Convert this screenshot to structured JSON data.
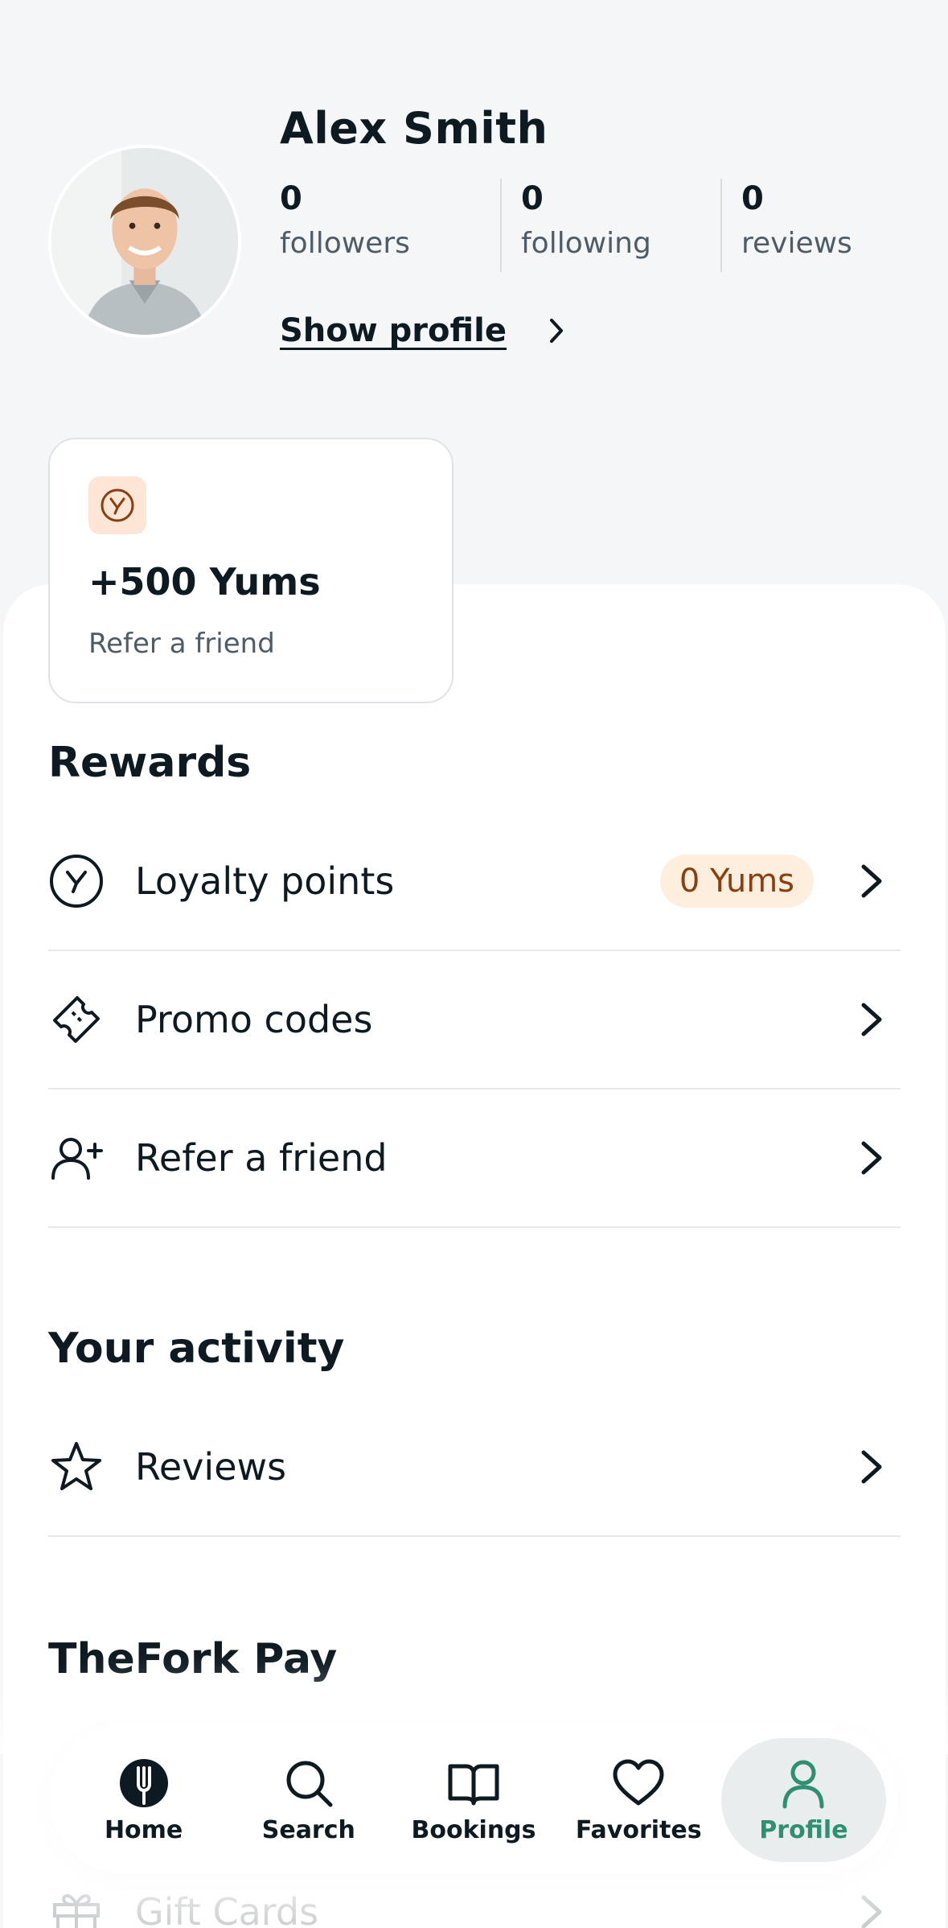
{
  "profile": {
    "name": "Alex Smith",
    "stats": [
      {
        "value": "0",
        "label": "followers"
      },
      {
        "value": "0",
        "label": "following"
      },
      {
        "value": "0",
        "label": "reviews"
      }
    ],
    "show_profile": "Show profile"
  },
  "yums_card": {
    "title": "+500 Yums",
    "subtitle": "Refer a friend",
    "icon": "yums-coin-icon"
  },
  "rewards": {
    "title": "Rewards",
    "items": [
      {
        "label": "Loyalty points",
        "badge": "0 Yums",
        "icon": "yums-circle-icon"
      },
      {
        "label": "Promo codes",
        "icon": "ticket-icon"
      },
      {
        "label": "Refer a friend",
        "icon": "user-plus-icon"
      }
    ]
  },
  "activity": {
    "title": "Your activity",
    "items": [
      {
        "label": "Reviews",
        "icon": "star-icon"
      }
    ]
  },
  "thefork_pay": {
    "title": "TheFork Pay",
    "items": [
      {
        "label": "Gift Cards",
        "icon": "gift-icon"
      }
    ]
  },
  "tabbar": {
    "tabs": [
      {
        "label": "Home",
        "icon": "thefork-home-icon"
      },
      {
        "label": "Search",
        "icon": "search-icon"
      },
      {
        "label": "Bookings",
        "icon": "book-icon"
      },
      {
        "label": "Favorites",
        "icon": "heart-icon"
      },
      {
        "label": "Profile",
        "icon": "person-icon",
        "active": true
      }
    ]
  },
  "colors": {
    "accent": "#2f8f73",
    "badge_bg": "#fdeedd",
    "badge_text": "#8a3f10",
    "background": "#f5f6f7"
  }
}
